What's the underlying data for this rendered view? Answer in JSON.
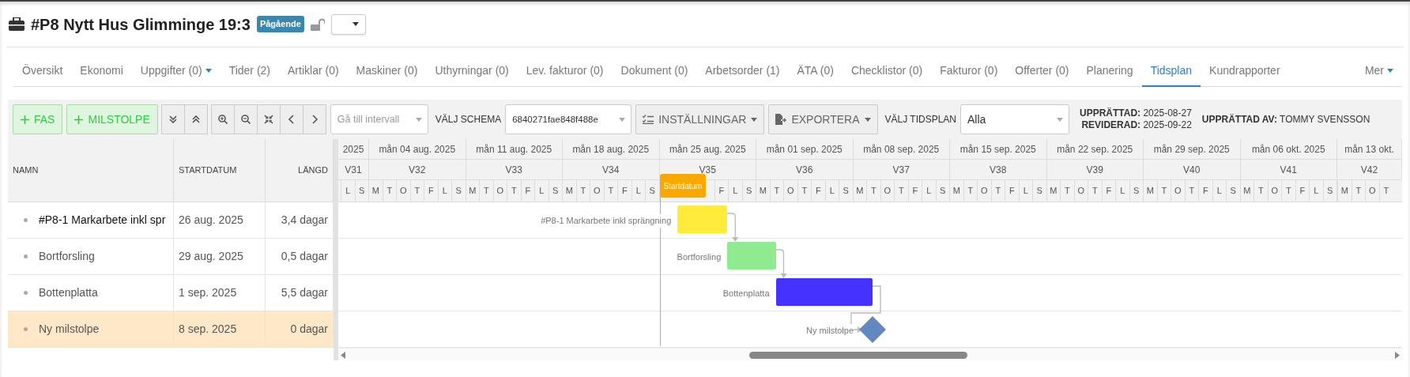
{
  "header": {
    "title": "#P8 Nytt Hus Glimminge 19:3",
    "status_badge": "Pågående",
    "locked": false
  },
  "tabs": [
    {
      "label": "Översikt",
      "selected": false,
      "dropdown": false
    },
    {
      "label": "Ekonomi",
      "selected": false,
      "dropdown": false
    },
    {
      "label": "Uppgifter (0)",
      "selected": false,
      "dropdown": true
    },
    {
      "label": "Tider (2)",
      "selected": false,
      "dropdown": false
    },
    {
      "label": "Artiklar (0)",
      "selected": false,
      "dropdown": false
    },
    {
      "label": "Maskiner (0)",
      "selected": false,
      "dropdown": false
    },
    {
      "label": "Uthyrningar (0)",
      "selected": false,
      "dropdown": false
    },
    {
      "label": "Lev. fakturor (0)",
      "selected": false,
      "dropdown": false
    },
    {
      "label": "Dokument (0)",
      "selected": false,
      "dropdown": false
    },
    {
      "label": "Arbetsorder (1)",
      "selected": false,
      "dropdown": false
    },
    {
      "label": "ÄTA (0)",
      "selected": false,
      "dropdown": false
    },
    {
      "label": "Checklistor (0)",
      "selected": false,
      "dropdown": false
    },
    {
      "label": "Fakturor (0)",
      "selected": false,
      "dropdown": false
    },
    {
      "label": "Offerter (0)",
      "selected": false,
      "dropdown": false
    },
    {
      "label": "Planering",
      "selected": false,
      "dropdown": false
    },
    {
      "label": "Tidsplan",
      "selected": true,
      "dropdown": false
    },
    {
      "label": "Kundrapporter",
      "selected": false,
      "dropdown": false
    }
  ],
  "more_menu": {
    "label": "Mer"
  },
  "toolbar": {
    "add_buttons": [
      {
        "label": "FAS"
      },
      {
        "label": "MILSTOLPE"
      }
    ],
    "interval_select": {
      "placeholder": "Gå till intervall"
    },
    "schema_label": "VÄLJ SCHEMA",
    "schema_select": {
      "value": "6840271fae848f488e"
    },
    "settings_button": {
      "label": "INSTÄLLNINGAR"
    },
    "export_button": {
      "label": "EXPORTERA"
    },
    "timeplan_label": "VÄLJ TIDSPLAN",
    "timeplan_select": {
      "value": "Alla"
    },
    "created": "**UPPRÄTTAD:** 2025-08-27",
    "revised": "**REVIDERAD:** 2025-09-22",
    "created_by": "**UPPRÄTTAD AV:** TOMMY SVENSSON"
  },
  "grid": {
    "columns": [
      "NAMN",
      "STARTDATUM",
      "LÄNGD"
    ],
    "rows": [
      {
        "kind": "phase",
        "name": "#P8-1 Markarbete inkl spr",
        "start": "26 aug. 2025",
        "duration": "3,4 dagar",
        "selected": false
      },
      {
        "kind": "task",
        "name": "Bortforsling",
        "start": "29 aug. 2025",
        "duration": "0,5 dagar",
        "selected": false
      },
      {
        "kind": "task",
        "name": "Bottenplatta",
        "start": "1 sep. 2025",
        "duration": "5,5 dagar",
        "selected": false
      },
      {
        "kind": "milestone",
        "name": "Ny milstolpe",
        "start": "8 sep. 2025",
        "duration": "0 dagar",
        "selected": true
      }
    ]
  },
  "timeline": {
    "weeks": [
      {
        "date": "2025",
        "week": "V31",
        "days": [
          "L",
          "S"
        ]
      },
      {
        "date": "mån 04 aug. 2025",
        "week": "V32",
        "days": [
          "M",
          "T",
          "O",
          "T",
          "F",
          "L",
          "S"
        ]
      },
      {
        "date": "mån 11 aug. 2025",
        "week": "V33",
        "days": [
          "M",
          "T",
          "O",
          "T",
          "F",
          "L",
          "S"
        ]
      },
      {
        "date": "mån 18 aug. 2025",
        "week": "V34",
        "days": [
          "M",
          "T",
          "O",
          "T",
          "F",
          "L",
          "S"
        ]
      },
      {
        "date": "mån 25 aug. 2025",
        "week": "V35",
        "days": [
          "F",
          "L",
          "S"
        ]
      },
      {
        "date": "mån 01 sep. 2025",
        "week": "V36",
        "days": [
          "M",
          "T",
          "O",
          "T",
          "F",
          "L",
          "S"
        ]
      },
      {
        "date": "mån 08 sep. 2025",
        "week": "V37",
        "days": [
          "M",
          "T",
          "O",
          "T",
          "F",
          "L",
          "S"
        ]
      },
      {
        "date": "mån 15 sep. 2025",
        "week": "V38",
        "days": [
          "M",
          "T",
          "O",
          "T",
          "F",
          "L",
          "S"
        ]
      },
      {
        "date": "mån 22 sep. 2025",
        "week": "V39",
        "days": [
          "M",
          "T",
          "O",
          "T",
          "F",
          "L",
          "S"
        ]
      },
      {
        "date": "mån 29 sep. 2025",
        "week": "V40",
        "days": [
          "M",
          "T",
          "O",
          "T",
          "F",
          "L",
          "S"
        ]
      },
      {
        "date": "mån 06 okt. 2025",
        "week": "V41",
        "days": [
          "M",
          "T",
          "O",
          "T",
          "F",
          "L",
          "S"
        ]
      },
      {
        "date": "mån 13 okt.",
        "week": "V42",
        "days": [
          "M",
          "T",
          "O",
          "T"
        ]
      }
    ],
    "start_marker": {
      "label": "Startdatum"
    }
  },
  "bars": [
    {
      "kind": "task",
      "label": "#P8-1 Markarbete inkl sprängning",
      "color": "#ffeb3b"
    },
    {
      "kind": "task",
      "label": "Bortforsling",
      "color": "#90ea90"
    },
    {
      "kind": "task",
      "label": "Bottenplatta",
      "color": "#4433ff"
    },
    {
      "kind": "milestone",
      "label": "Ny milstolpe",
      "color": "#6388c0"
    }
  ]
}
